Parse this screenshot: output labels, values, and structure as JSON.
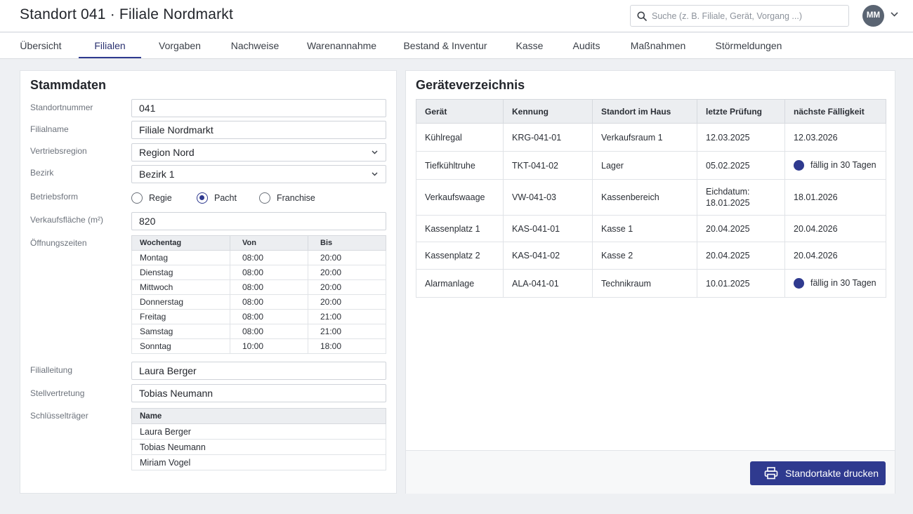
{
  "header": {
    "title": "Standort 041 · Filiale Nordmarkt",
    "search_placeholder": "Suche (z. B. Filiale, Gerät, Vorgang ...)",
    "avatar_initials": "MM"
  },
  "tabs": [
    {
      "label": "Übersicht",
      "active": false
    },
    {
      "label": "Filialen",
      "active": true
    },
    {
      "label": "Vorgaben",
      "active": false
    },
    {
      "label": "Nachweise",
      "active": false
    },
    {
      "label": "Warenannahme",
      "active": false
    },
    {
      "label": "Bestand & Inventur",
      "active": false
    },
    {
      "label": "Kasse",
      "active": false
    },
    {
      "label": "Audits",
      "active": false
    },
    {
      "label": "Maßnahmen",
      "active": false
    },
    {
      "label": "Störmeldungen",
      "active": false
    }
  ],
  "stammdaten": {
    "title": "Stammdaten",
    "standortnummer": {
      "label": "Standortnummer",
      "value": "041"
    },
    "filialname": {
      "label": "Filialname",
      "value": "Filiale Nordmarkt"
    },
    "vertriebsregion": {
      "label": "Vertriebsregion",
      "value": "Region Nord"
    },
    "bezirk": {
      "label": "Bezirk",
      "value": "Bezirk 1"
    },
    "betriebsform": {
      "label": "Betriebsform",
      "options": [
        "Regie",
        "Pacht",
        "Franchise"
      ],
      "selected": "Pacht"
    },
    "verkaufsflaeche": {
      "label": "Verkaufsfläche (m²)",
      "value": "820"
    },
    "oeffnungszeiten": {
      "label": "Öffnungszeiten",
      "headers": [
        "Wochentag",
        "Von",
        "Bis"
      ],
      "rows": [
        [
          "Montag",
          "08:00",
          "20:00"
        ],
        [
          "Dienstag",
          "08:00",
          "20:00"
        ],
        [
          "Mittwoch",
          "08:00",
          "20:00"
        ],
        [
          "Donnerstag",
          "08:00",
          "20:00"
        ],
        [
          "Freitag",
          "08:00",
          "21:00"
        ],
        [
          "Samstag",
          "08:00",
          "21:00"
        ],
        [
          "Sonntag",
          "10:00",
          "18:00"
        ]
      ]
    },
    "filialleitung": {
      "label": "Filialleitung",
      "value": "Laura Berger"
    },
    "stellvertretung": {
      "label": "Stellvertretung",
      "value": "Tobias Neumann"
    },
    "schluesseltraeger": {
      "label": "Schlüsselträger",
      "header": "Name",
      "rows": [
        "Laura Berger",
        "Tobias Neumann",
        "Miriam Vogel"
      ]
    }
  },
  "geraete": {
    "title": "Geräteverzeichnis",
    "headers": [
      "Gerät",
      "Kennung",
      "Standort im Haus",
      "letzte Prüfung",
      "nächste Fälligkeit"
    ],
    "rows": [
      {
        "geraet": "Kühlregal",
        "kennung": "KRG-041-01",
        "standort": "Verkaufsraum 1",
        "letzte": "12.03.2025",
        "naechste": "12.03.2026",
        "due_soon": false
      },
      {
        "geraet": "Tiefkühltruhe",
        "kennung": "TKT-041-02",
        "standort": "Lager",
        "letzte": "05.02.2025",
        "naechste": "fällig in 30 Tagen",
        "due_soon": true
      },
      {
        "geraet": "Verkaufswaage",
        "kennung": "VW-041-03",
        "standort": "Kassenbereich",
        "letzte": "Eichdatum:\n18.01.2025",
        "naechste": "18.01.2026",
        "due_soon": false
      },
      {
        "geraet": "Kassenplatz 1",
        "kennung": "KAS-041-01",
        "standort": "Kasse 1",
        "letzte": "20.04.2025",
        "naechste": "20.04.2026",
        "due_soon": false
      },
      {
        "geraet": "Kassenplatz 2",
        "kennung": "KAS-041-02",
        "standort": "Kasse 2",
        "letzte": "20.04.2025",
        "naechste": "20.04.2026",
        "due_soon": false
      },
      {
        "geraet": "Alarmanlage",
        "kennung": "ALA-041-01",
        "standort": "Technikraum",
        "letzte": "10.01.2025",
        "naechste": "fällig in 30 Tagen",
        "due_soon": true
      }
    ],
    "print_button": "Standortakte drucken"
  },
  "colors": {
    "accent": "#2f3a8f",
    "due_dot": "#2f3a8f"
  }
}
